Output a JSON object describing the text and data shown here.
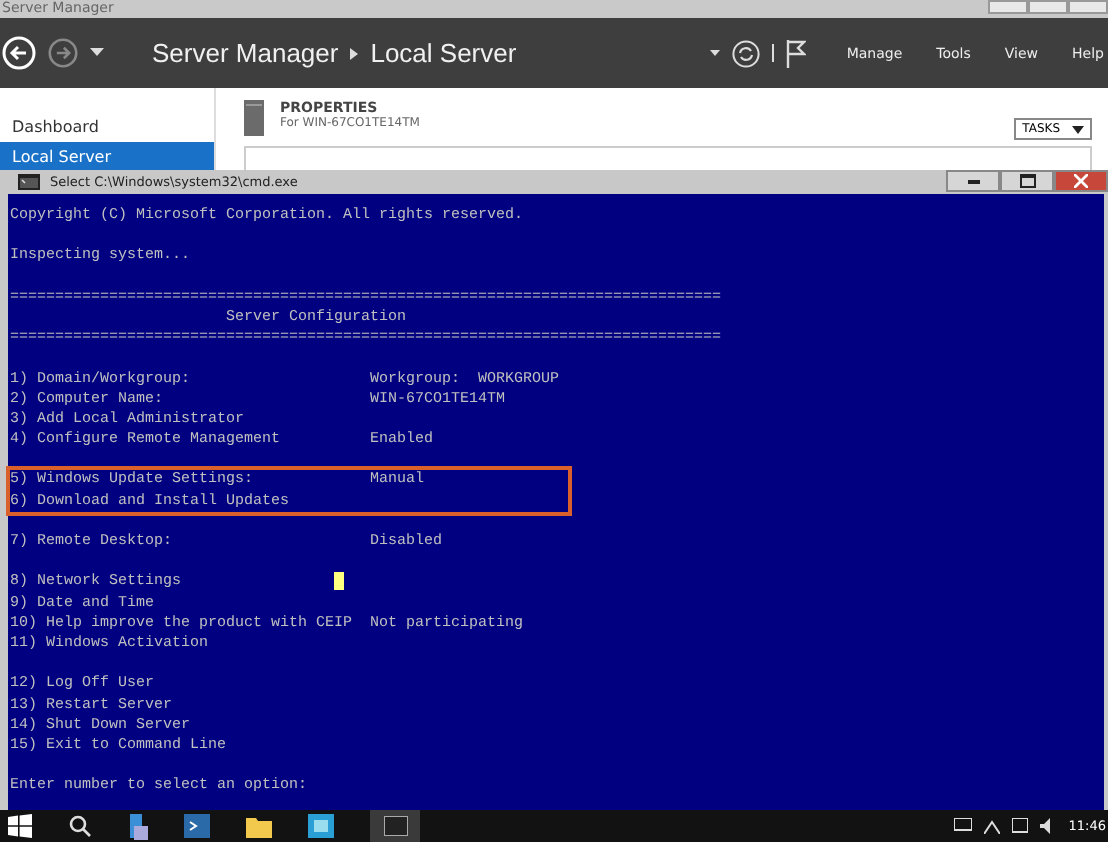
{
  "server_manager": {
    "window_title": "Server Manager",
    "breadcrumb": [
      "Server Manager",
      "Local Server"
    ],
    "menu": [
      "Manage",
      "Tools",
      "View",
      "Help"
    ],
    "sidebar": {
      "items": [
        {
          "label": "Dashboard",
          "selected": false
        },
        {
          "label": "Local Server",
          "selected": true
        }
      ]
    },
    "properties": {
      "title": "PROPERTIES",
      "subtitle": "For WIN-67CO1TE14TM",
      "tasks_button": "TASKS"
    }
  },
  "cmd_window": {
    "title": "Select C:\\Windows\\system32\\cmd.exe",
    "intro": [
      "Copyright (C) Microsoft Corporation. All rights reserved.",
      "Inspecting system..."
    ],
    "rule": "===============================================================================",
    "banner": "Server Configuration",
    "groups": [
      {
        "highlighted": false,
        "items": [
          {
            "label": "1) Domain/Workgroup:",
            "value": "Workgroup:  WORKGROUP"
          },
          {
            "label": "2) Computer Name:",
            "value": "WIN-67CO1TE14TM"
          },
          {
            "label": "3) Add Local Administrator"
          },
          {
            "label": "4) Configure Remote Management",
            "value": "Enabled"
          }
        ]
      },
      {
        "highlighted": true,
        "items": [
          {
            "label": "5) Windows Update Settings:",
            "value": "Manual"
          },
          {
            "label": "6) Download and Install Updates"
          }
        ]
      },
      {
        "highlighted": false,
        "items": [
          {
            "label": "7) Remote Desktop:",
            "value": "Disabled"
          }
        ]
      },
      {
        "highlighted": false,
        "items": [
          {
            "label": "8) Network Settings",
            "cursor": true
          },
          {
            "label": "9) Date and Time"
          },
          {
            "label": "10) Help improve the product with CEIP",
            "value": "Not participating"
          },
          {
            "label": "11) Windows Activation"
          }
        ]
      },
      {
        "highlighted": false,
        "items": [
          {
            "label": "12) Log Off User"
          },
          {
            "label": "13) Restart Server"
          },
          {
            "label": "14) Shut Down Server"
          },
          {
            "label": "15) Exit to Command Line"
          }
        ]
      }
    ],
    "prompt": "Enter number to select an option:"
  },
  "taskbar": {
    "clock": "11:46"
  }
}
